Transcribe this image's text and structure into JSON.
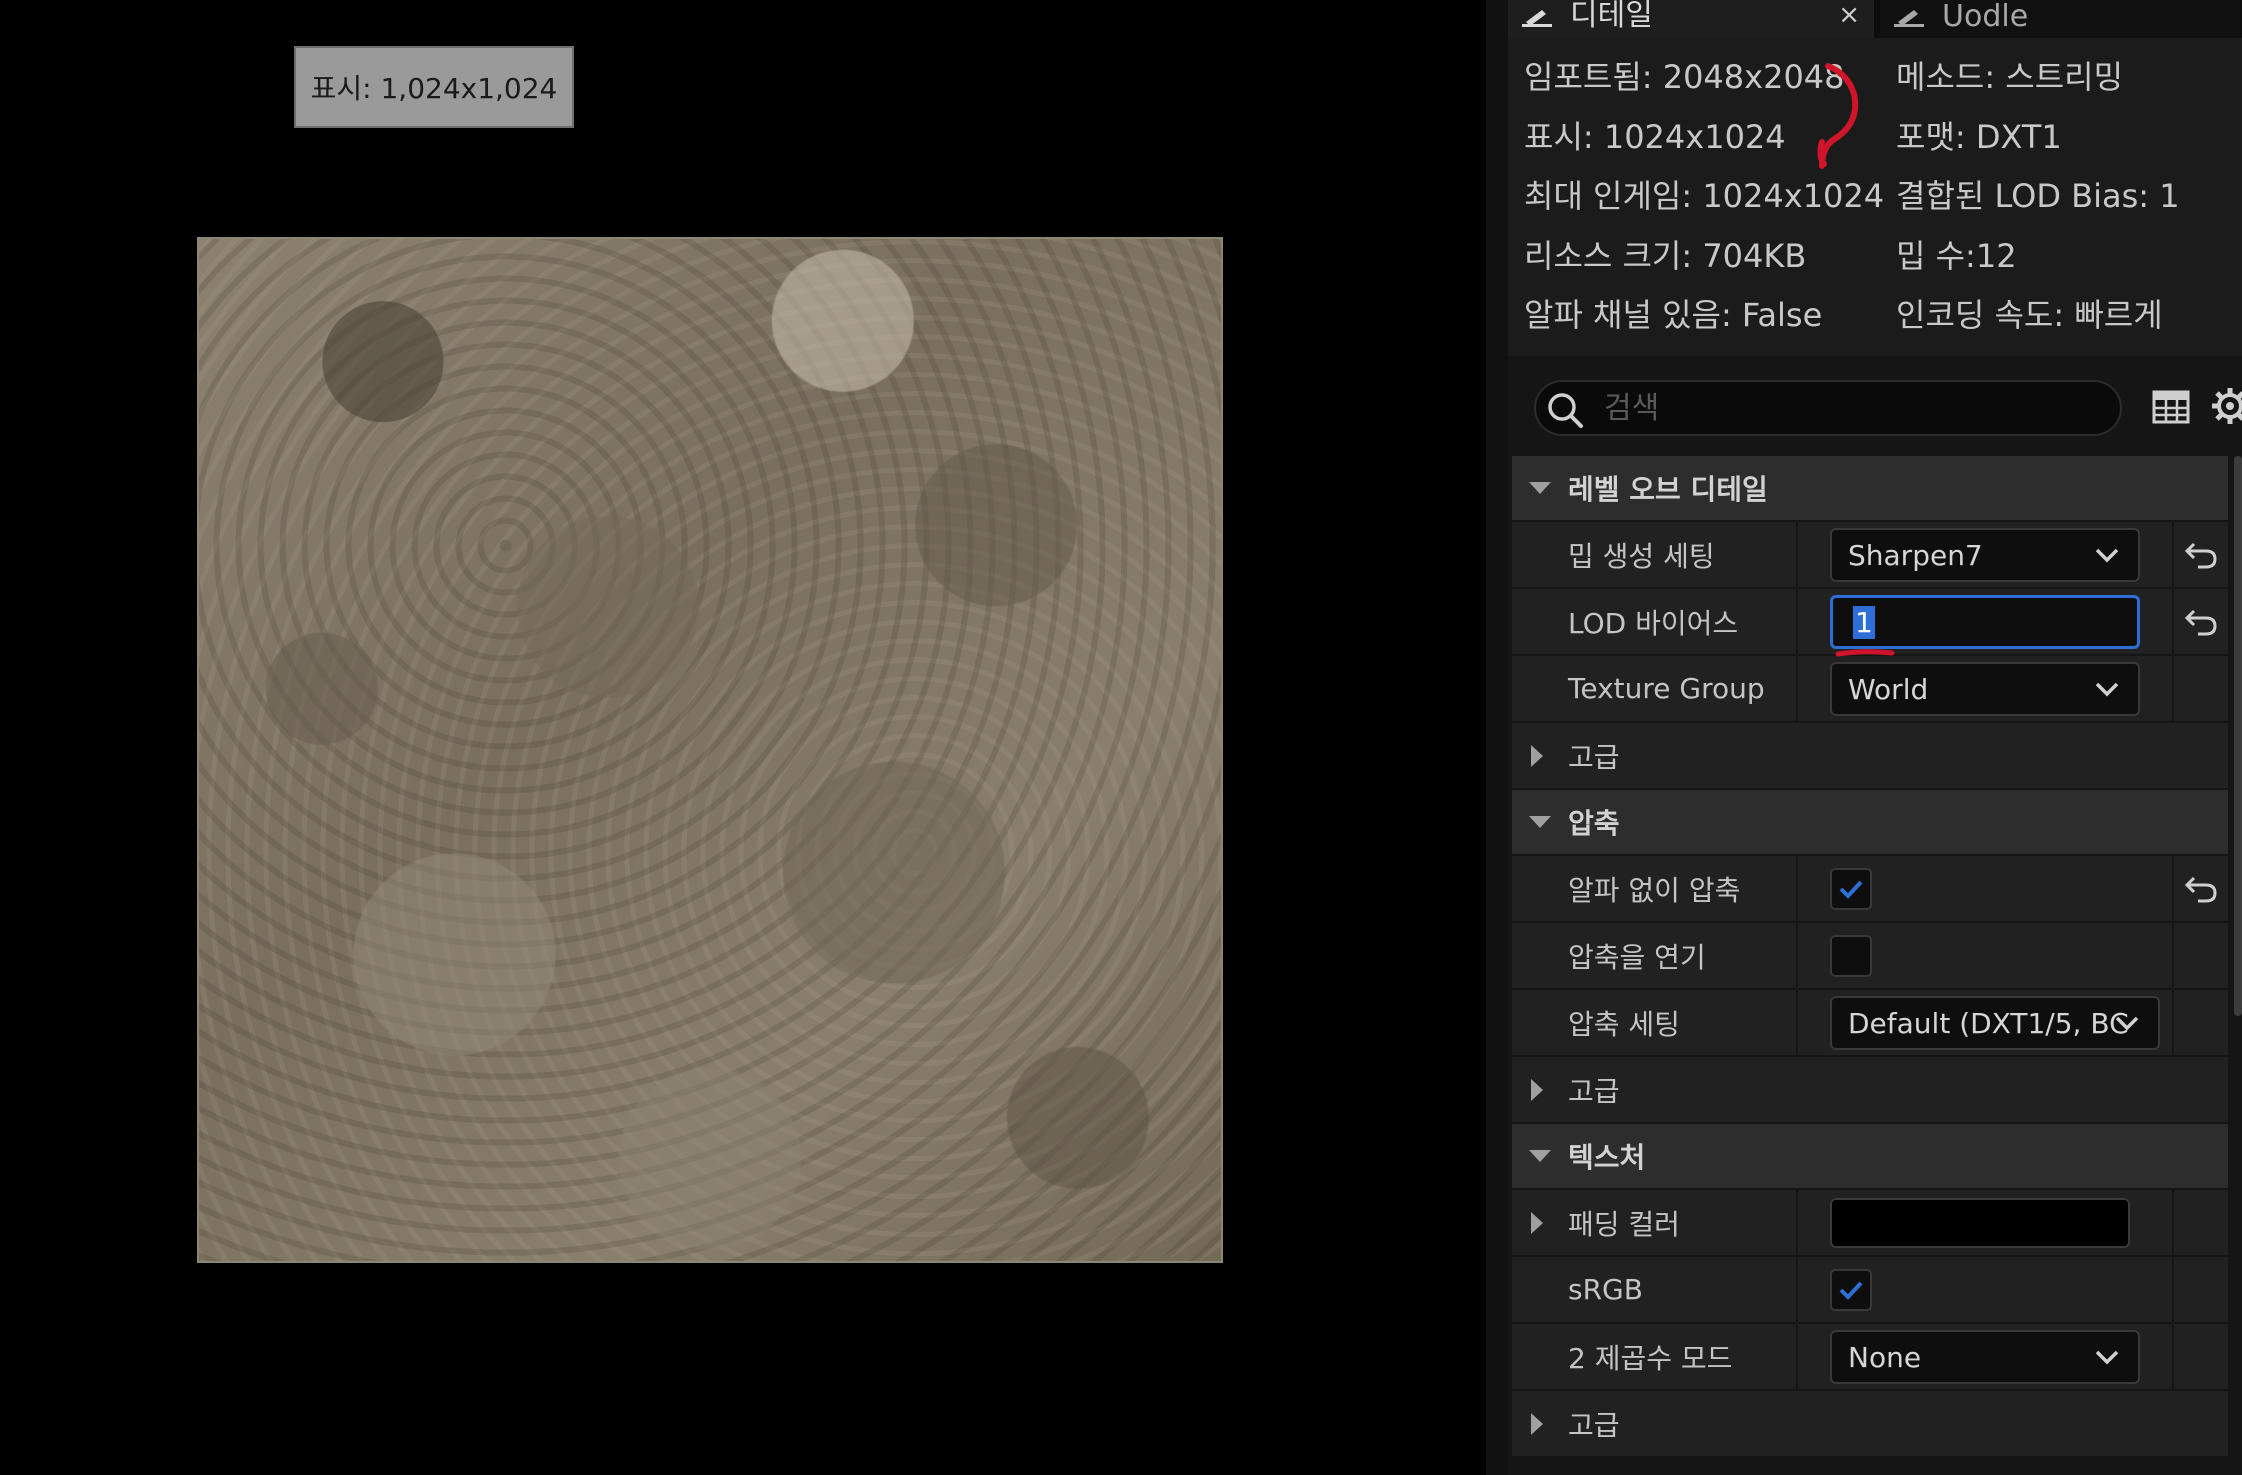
{
  "viewport": {
    "display_label": "표시: 1,024x1,024"
  },
  "tabs": {
    "details_label": "디테일",
    "close_glyph": "×",
    "other_label": "Uodle"
  },
  "info": {
    "imported": "임포트됨: 2048x2048",
    "displayed": "표시: 1024x1024",
    "max_ingame": "최대 인게임: 1024x1024",
    "resource_size": "리소스 크기: 704KB",
    "has_alpha": "알파 채널 있음: False",
    "method": "메소드: 스트리밍",
    "format": "포맷: DXT1",
    "combined_lod_bias": "결합된 LOD Bias: 1",
    "mip_count": "밉 수:12",
    "encode_speed": "인코딩 속도: 빠르게"
  },
  "search": {
    "placeholder": "검색"
  },
  "categories": {
    "level_of_detail": "레벨 오브 디테일",
    "advanced_1": "고급",
    "compression": "압축",
    "advanced_2": "고급",
    "texture": "텍스처",
    "advanced_3": "고급"
  },
  "properties": {
    "mip_gen_settings": {
      "label": "밉 생성 세팅",
      "value": "Sharpen7"
    },
    "lod_bias": {
      "label": "LOD 바이어스",
      "value": "1"
    },
    "texture_group": {
      "label": "Texture Group",
      "value": "World"
    },
    "compress_without_alpha": {
      "label": "알파 없이 압축",
      "checked": true
    },
    "defer_compression": {
      "label": "압축을 연기",
      "checked": false
    },
    "compression_settings": {
      "label": "압축 세팅",
      "value": "Default (DXT1/5, BC"
    },
    "padding_color": {
      "label": "패딩 컬러",
      "color": "#000000"
    },
    "srgb": {
      "label": "sRGB",
      "checked": true
    },
    "power_of_two_mode": {
      "label": "2 제곱수 모드",
      "value": "None"
    }
  },
  "colors": {
    "accent": "#2d6fd6",
    "annotation": "#d0142a",
    "panel_bg": "#151515"
  }
}
